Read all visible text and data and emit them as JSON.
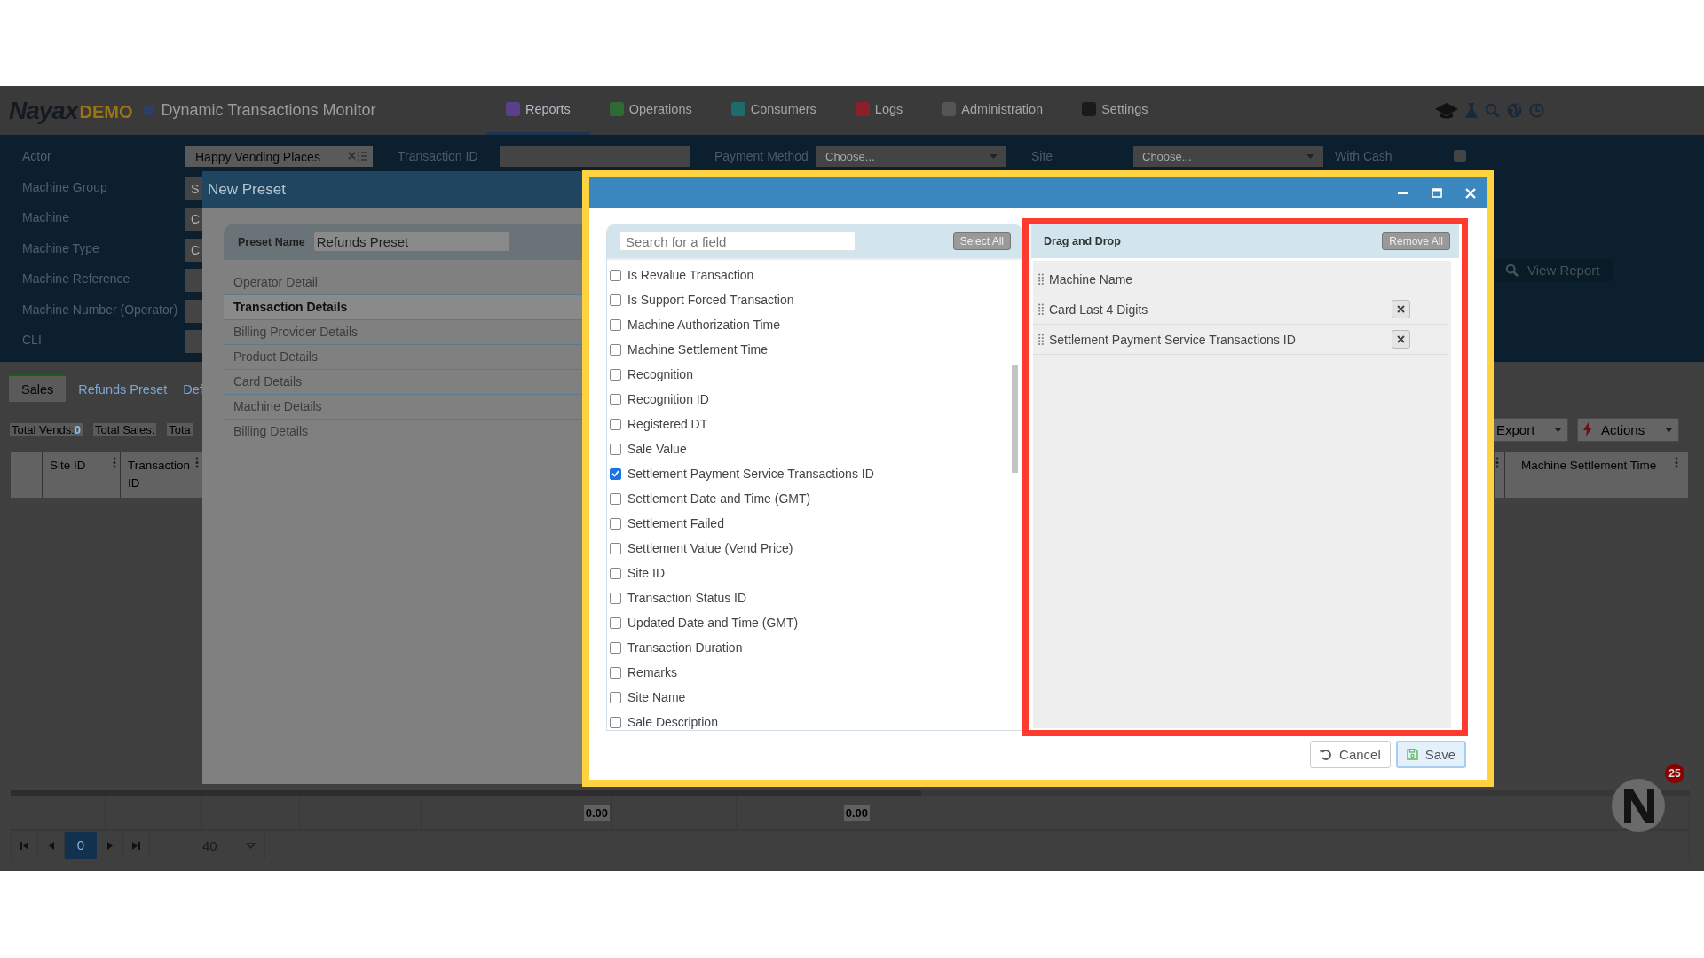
{
  "header": {
    "logo": "Nayax",
    "logo_suffix": "DEMO",
    "app_title": "Dynamic Transactions Monitor",
    "nav": [
      {
        "label": "Reports",
        "selected": true,
        "color": "#5a3f8c"
      },
      {
        "label": "Operations",
        "selected": false,
        "color": "#2e6b34"
      },
      {
        "label": "Consumers",
        "selected": false,
        "color": "#1f6b6b"
      },
      {
        "label": "Logs",
        "selected": false,
        "color": "#8c1f2a"
      },
      {
        "label": "Administration",
        "selected": false,
        "color": "#555555"
      },
      {
        "label": "Settings",
        "selected": false,
        "color": "#1a1a1a"
      }
    ]
  },
  "filters": {
    "side": [
      {
        "label": "Actor",
        "value": "Happy Vending Places"
      },
      {
        "label": "Machine Group",
        "value": "S"
      },
      {
        "label": "Machine",
        "value": "C"
      },
      {
        "label": "Machine Type",
        "value": "C"
      },
      {
        "label": "Machine Reference"
      },
      {
        "label": "Machine Number (Operator)"
      },
      {
        "label": "CLI"
      }
    ],
    "top": [
      {
        "label": "Transaction ID",
        "kind": "text"
      },
      {
        "label": "Payment Method",
        "kind": "select",
        "value": "Choose..."
      },
      {
        "label": "Site",
        "kind": "select",
        "value": "Choose..."
      }
    ],
    "with_cash": {
      "label": "With Cash",
      "checked": false
    },
    "view_report": "View Report"
  },
  "tabs": [
    {
      "label": "Sales",
      "selected": true
    },
    {
      "label": "Refunds Preset",
      "selected": false
    },
    {
      "label": "Def",
      "selected": false
    }
  ],
  "totals": [
    {
      "label": "Total Vends:",
      "value": "0"
    },
    {
      "label": "Total Sales:"
    },
    {
      "label": "Tota"
    }
  ],
  "toolbar": {
    "export": "Export",
    "actions": "Actions"
  },
  "grid": {
    "left_columns": [
      "Site ID",
      "Transaction ID"
    ],
    "right_columns": [
      "Machine Settlement Time"
    ],
    "footer": [
      "0.00",
      "0.00"
    ]
  },
  "pager": {
    "page": "0",
    "page_size": "40"
  },
  "chat_badge": "25",
  "new_preset": {
    "title": "New Preset",
    "name_label": "Preset Name",
    "name_value": "Refunds Preset",
    "categories": [
      {
        "label": "Operator Detail",
        "selected": false
      },
      {
        "label": "Transaction Details",
        "selected": true
      },
      {
        "label": "Billing Provider Details",
        "selected": false
      },
      {
        "label": "Product Details",
        "selected": false
      },
      {
        "label": "Card Details",
        "selected": false
      },
      {
        "label": "Machine Details",
        "selected": false
      },
      {
        "label": "Billing Details",
        "selected": false
      }
    ]
  },
  "field_picker": {
    "search_placeholder": "Search for a field",
    "select_all": "Select All",
    "fields": [
      {
        "label": "Is Revalue Transaction",
        "checked": false
      },
      {
        "label": "Is Support Forced Transaction",
        "checked": false
      },
      {
        "label": "Machine Authorization Time",
        "checked": false
      },
      {
        "label": "Machine Settlement Time",
        "checked": false
      },
      {
        "label": "Recognition",
        "checked": false
      },
      {
        "label": "Recognition ID",
        "checked": false
      },
      {
        "label": "Registered DT",
        "checked": false
      },
      {
        "label": "Sale Value",
        "checked": false
      },
      {
        "label": "Settlement Payment Service Transactions ID",
        "checked": true
      },
      {
        "label": "Settlement Date and Time (GMT)",
        "checked": false
      },
      {
        "label": "Settlement Failed",
        "checked": false
      },
      {
        "label": "Settlement Value (Vend Price)",
        "checked": false
      },
      {
        "label": "Site ID",
        "checked": false
      },
      {
        "label": "Transaction Status ID",
        "checked": false
      },
      {
        "label": "Updated Date and Time (GMT)",
        "checked": false
      },
      {
        "label": "Transaction Duration",
        "checked": false
      },
      {
        "label": "Remarks",
        "checked": false
      },
      {
        "label": "Site Name",
        "checked": false
      },
      {
        "label": "Sale Description",
        "checked": false
      }
    ],
    "selected_title": "Drag and Drop",
    "remove_all": "Remove All",
    "selected_fields": [
      {
        "label": "Machine Name",
        "removable": false
      },
      {
        "label": "Card Last 4 Digits",
        "removable": true
      },
      {
        "label": "Settlement Payment Service Transactions ID",
        "removable": true
      }
    ],
    "cancel": "Cancel",
    "save": "Save"
  }
}
